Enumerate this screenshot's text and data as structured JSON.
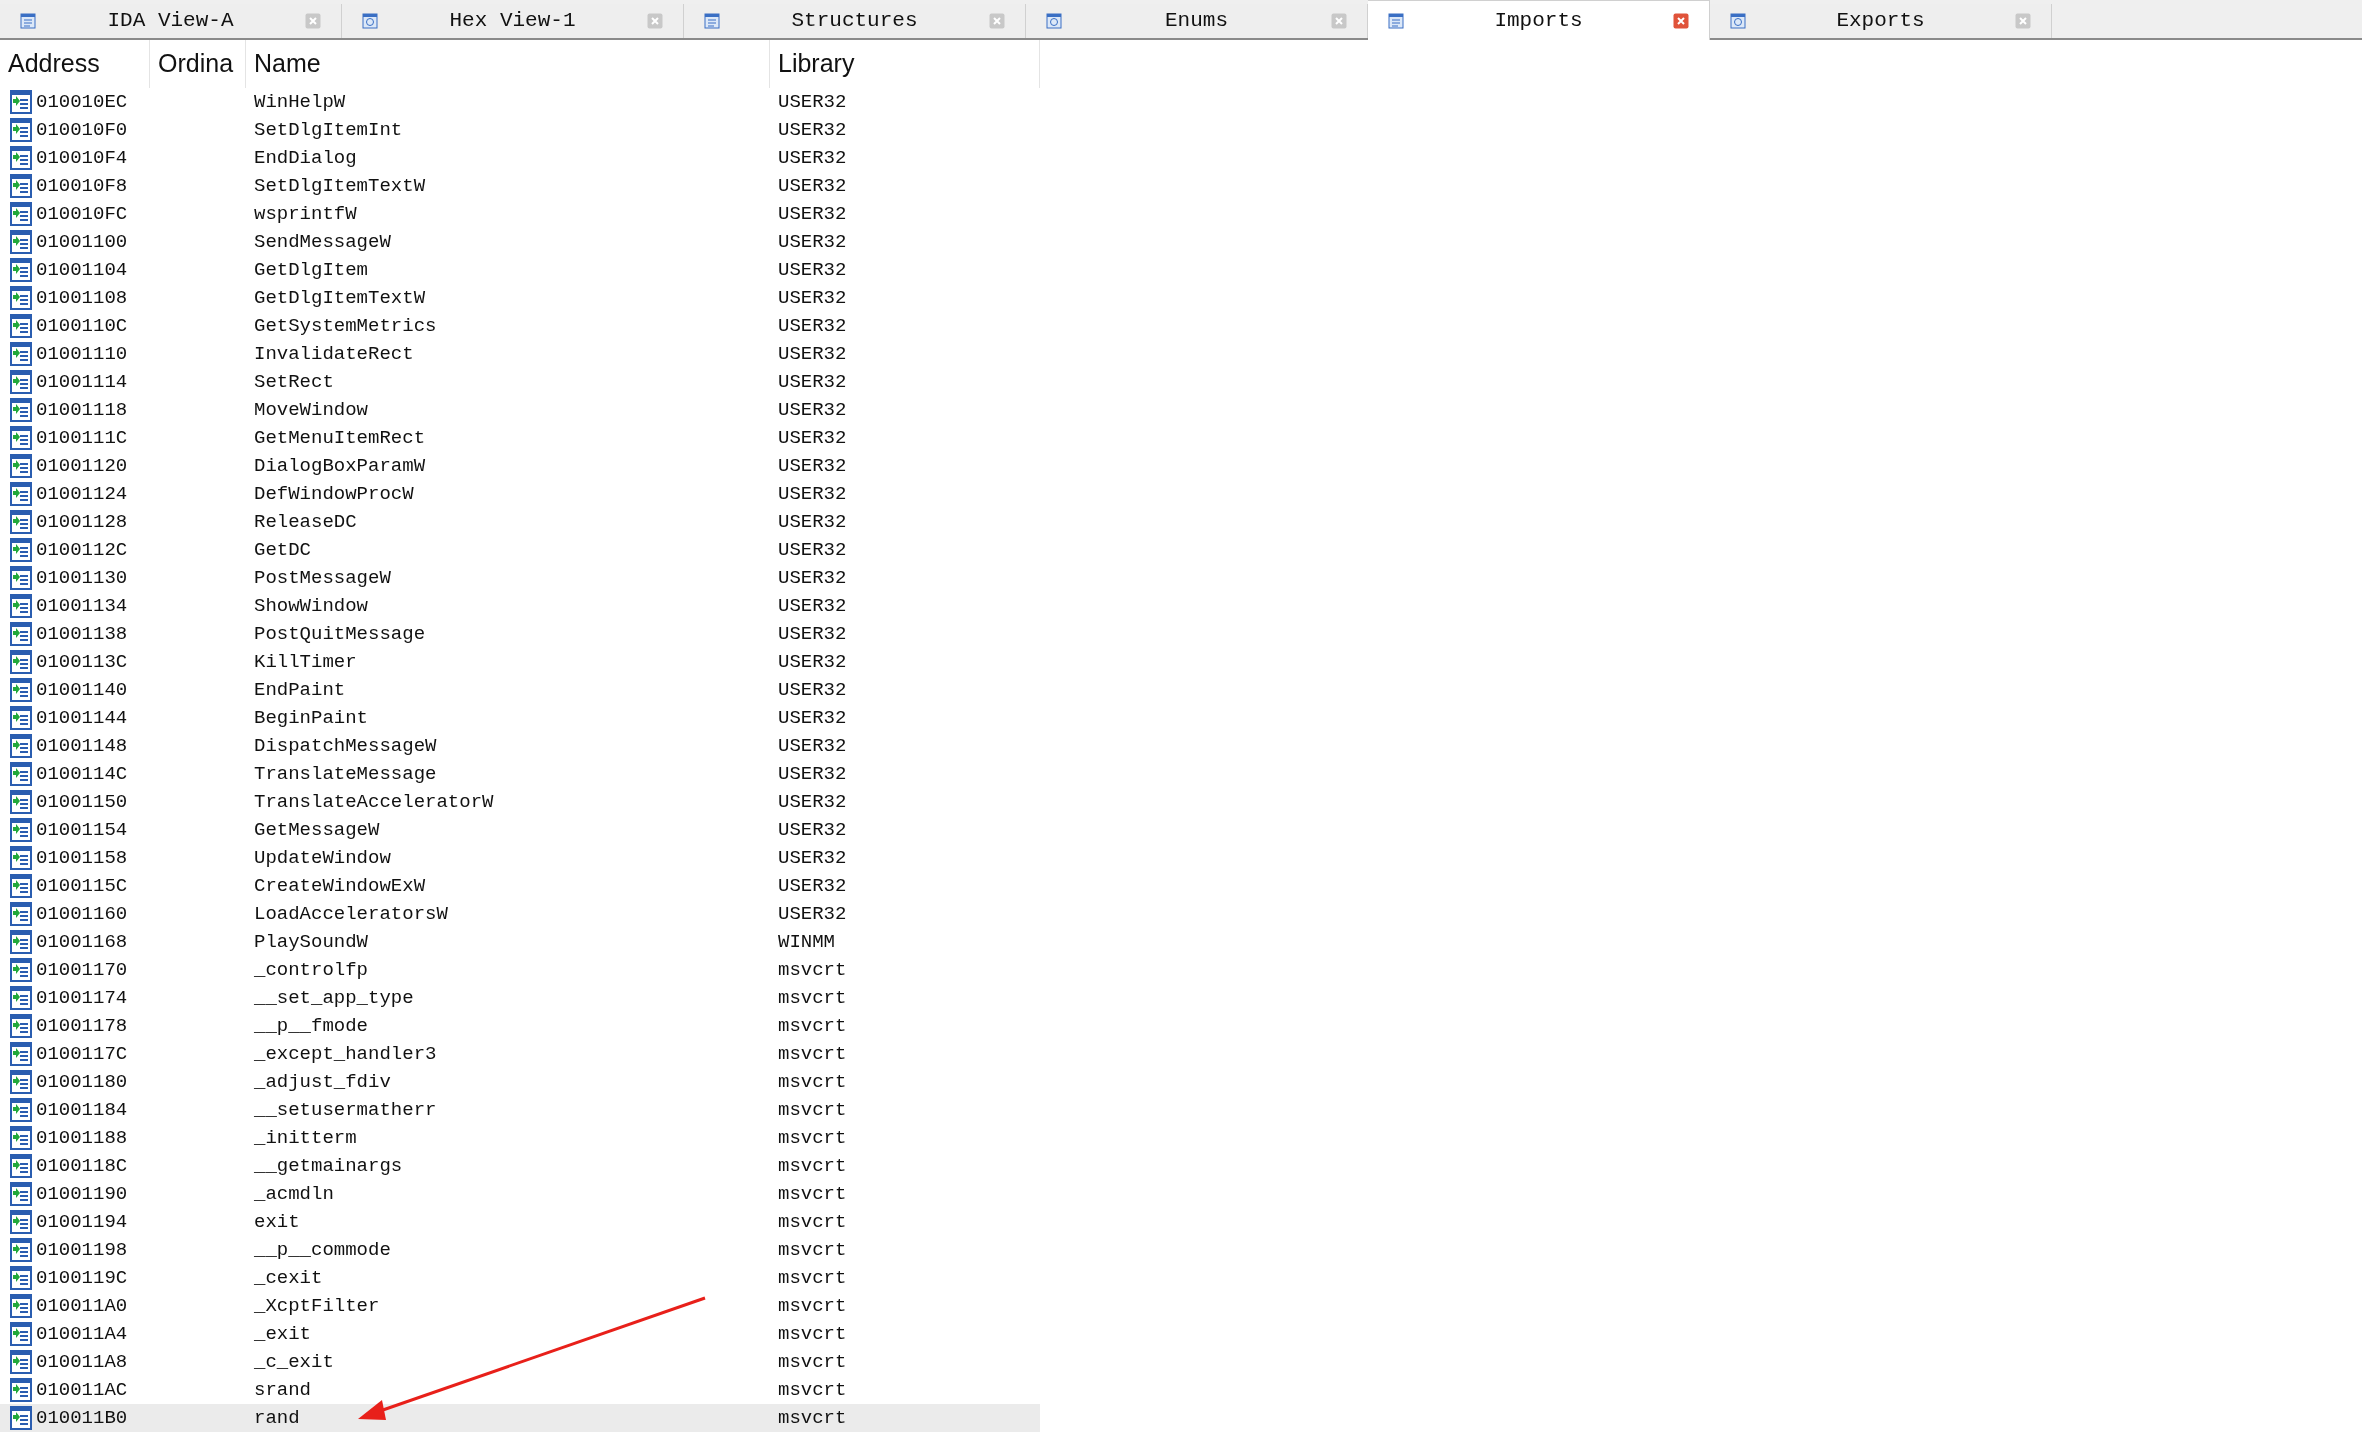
{
  "tabs": [
    {
      "label": "IDA View-A",
      "selected": false
    },
    {
      "label": "Hex View-1",
      "selected": false
    },
    {
      "label": "Structures",
      "selected": false
    },
    {
      "label": "Enums",
      "selected": false
    },
    {
      "label": "Imports",
      "selected": true
    },
    {
      "label": "Exports",
      "selected": false
    }
  ],
  "table": {
    "columns": [
      "Address",
      "Ordina",
      "Name",
      "Library"
    ],
    "rows": [
      {
        "address": "010010EC",
        "name": "WinHelpW",
        "library": "USER32",
        "selected": false
      },
      {
        "address": "010010F0",
        "name": "SetDlgItemInt",
        "library": "USER32",
        "selected": false
      },
      {
        "address": "010010F4",
        "name": "EndDialog",
        "library": "USER32",
        "selected": false
      },
      {
        "address": "010010F8",
        "name": "SetDlgItemTextW",
        "library": "USER32",
        "selected": false
      },
      {
        "address": "010010FC",
        "name": "wsprintfW",
        "library": "USER32",
        "selected": false
      },
      {
        "address": "01001100",
        "name": "SendMessageW",
        "library": "USER32",
        "selected": false
      },
      {
        "address": "01001104",
        "name": "GetDlgItem",
        "library": "USER32",
        "selected": false
      },
      {
        "address": "01001108",
        "name": "GetDlgItemTextW",
        "library": "USER32",
        "selected": false
      },
      {
        "address": "0100110C",
        "name": "GetSystemMetrics",
        "library": "USER32",
        "selected": false
      },
      {
        "address": "01001110",
        "name": "InvalidateRect",
        "library": "USER32",
        "selected": false
      },
      {
        "address": "01001114",
        "name": "SetRect",
        "library": "USER32",
        "selected": false
      },
      {
        "address": "01001118",
        "name": "MoveWindow",
        "library": "USER32",
        "selected": false
      },
      {
        "address": "0100111C",
        "name": "GetMenuItemRect",
        "library": "USER32",
        "selected": false
      },
      {
        "address": "01001120",
        "name": "DialogBoxParamW",
        "library": "USER32",
        "selected": false
      },
      {
        "address": "01001124",
        "name": "DefWindowProcW",
        "library": "USER32",
        "selected": false
      },
      {
        "address": "01001128",
        "name": "ReleaseDC",
        "library": "USER32",
        "selected": false
      },
      {
        "address": "0100112C",
        "name": "GetDC",
        "library": "USER32",
        "selected": false
      },
      {
        "address": "01001130",
        "name": "PostMessageW",
        "library": "USER32",
        "selected": false
      },
      {
        "address": "01001134",
        "name": "ShowWindow",
        "library": "USER32",
        "selected": false
      },
      {
        "address": "01001138",
        "name": "PostQuitMessage",
        "library": "USER32",
        "selected": false
      },
      {
        "address": "0100113C",
        "name": "KillTimer",
        "library": "USER32",
        "selected": false
      },
      {
        "address": "01001140",
        "name": "EndPaint",
        "library": "USER32",
        "selected": false
      },
      {
        "address": "01001144",
        "name": "BeginPaint",
        "library": "USER32",
        "selected": false
      },
      {
        "address": "01001148",
        "name": "DispatchMessageW",
        "library": "USER32",
        "selected": false
      },
      {
        "address": "0100114C",
        "name": "TranslateMessage",
        "library": "USER32",
        "selected": false
      },
      {
        "address": "01001150",
        "name": "TranslateAcceleratorW",
        "library": "USER32",
        "selected": false
      },
      {
        "address": "01001154",
        "name": "GetMessageW",
        "library": "USER32",
        "selected": false
      },
      {
        "address": "01001158",
        "name": "UpdateWindow",
        "library": "USER32",
        "selected": false
      },
      {
        "address": "0100115C",
        "name": "CreateWindowExW",
        "library": "USER32",
        "selected": false
      },
      {
        "address": "01001160",
        "name": "LoadAcceleratorsW",
        "library": "USER32",
        "selected": false
      },
      {
        "address": "01001168",
        "name": "PlaySoundW",
        "library": "WINMM",
        "selected": false
      },
      {
        "address": "01001170",
        "name": "_controlfp",
        "library": "msvcrt",
        "selected": false
      },
      {
        "address": "01001174",
        "name": "__set_app_type",
        "library": "msvcrt",
        "selected": false
      },
      {
        "address": "01001178",
        "name": "__p__fmode",
        "library": "msvcrt",
        "selected": false
      },
      {
        "address": "0100117C",
        "name": "_except_handler3",
        "library": "msvcrt",
        "selected": false
      },
      {
        "address": "01001180",
        "name": "_adjust_fdiv",
        "library": "msvcrt",
        "selected": false
      },
      {
        "address": "01001184",
        "name": "__setusermatherr",
        "library": "msvcrt",
        "selected": false
      },
      {
        "address": "01001188",
        "name": "_initterm",
        "library": "msvcrt",
        "selected": false
      },
      {
        "address": "0100118C",
        "name": "__getmainargs",
        "library": "msvcrt",
        "selected": false
      },
      {
        "address": "01001190",
        "name": "_acmdln",
        "library": "msvcrt",
        "selected": false
      },
      {
        "address": "01001194",
        "name": "exit",
        "library": "msvcrt",
        "selected": false
      },
      {
        "address": "01001198",
        "name": "__p__commode",
        "library": "msvcrt",
        "selected": false
      },
      {
        "address": "0100119C",
        "name": "_cexit",
        "library": "msvcrt",
        "selected": false
      },
      {
        "address": "010011A0",
        "name": "_XcptFilter",
        "library": "msvcrt",
        "selected": false
      },
      {
        "address": "010011A4",
        "name": "_exit",
        "library": "msvcrt",
        "selected": false
      },
      {
        "address": "010011A8",
        "name": "_c_exit",
        "library": "msvcrt",
        "selected": false
      },
      {
        "address": "010011AC",
        "name": "srand",
        "library": "msvcrt",
        "selected": false
      },
      {
        "address": "010011B0",
        "name": "rand",
        "library": "msvcrt",
        "selected": true
      }
    ]
  }
}
